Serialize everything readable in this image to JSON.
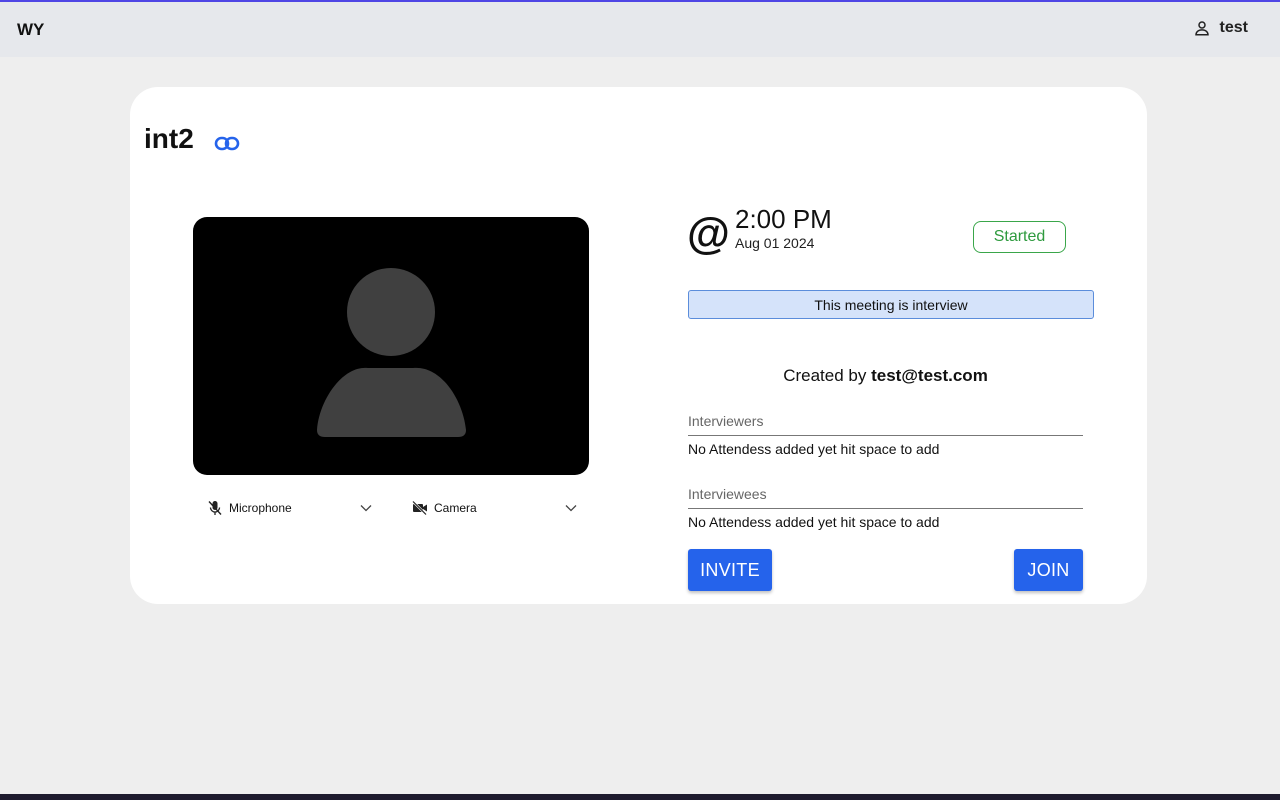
{
  "header": {
    "brand": "WY",
    "user_name": "test"
  },
  "meeting": {
    "title": "int2",
    "at_symbol": "@",
    "time": "2:00 PM",
    "date": "Aug 01 2024",
    "status": "Started",
    "notice": "This meeting is interview",
    "created_prefix": "Created by",
    "created_by": "test@test.com"
  },
  "devices": {
    "microphone_label": "Microphone",
    "camera_label": "Camera"
  },
  "fields": {
    "interviewers_label": "Interviewers",
    "interviewers_empty": "No Attendess added yet hit space to add",
    "interviewees_label": "Interviewees",
    "interviewees_empty": "No Attendess added yet hit space to add"
  },
  "actions": {
    "invite_label": "INVITE",
    "join_label": "JOIN"
  },
  "colors": {
    "accent": "#2563eb",
    "status_green": "#2e9a3e",
    "notice_bg": "#d5e3fa",
    "topbar_bg": "#e6e8ec"
  },
  "icons": {
    "user": "user-icon",
    "link": "link-icon",
    "microphone": "microphone-off-icon",
    "camera": "camera-off-icon",
    "chevron": "chevron-down-icon"
  }
}
